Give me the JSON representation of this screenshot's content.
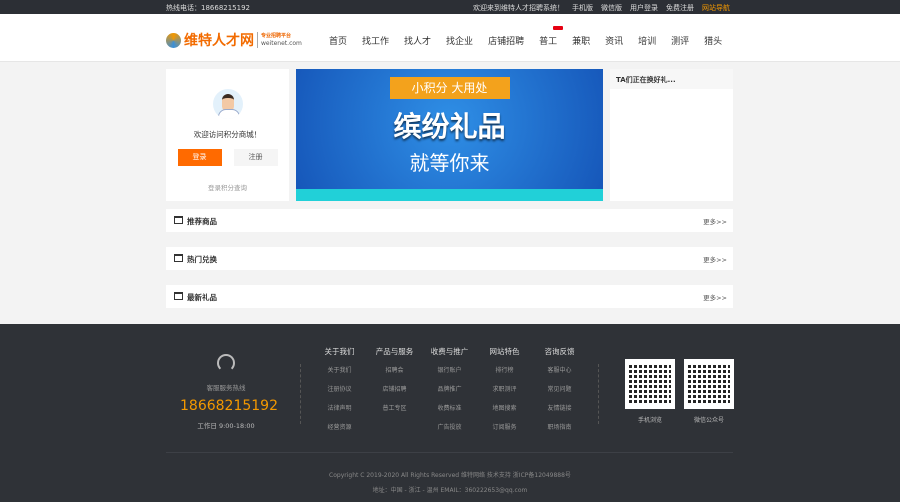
{
  "topbar": {
    "hotline": "热线电话：18668215192",
    "welcome": "欢迎来到维特人才招聘系统！",
    "links": [
      "手机版",
      "微信版",
      "用户登录",
      "免费注册",
      "网站导航"
    ]
  },
  "logo": {
    "name": "维特人才网",
    "slogan": "专业招聘平台",
    "domain": "weitenet.com"
  },
  "nav": [
    "首页",
    "找工作",
    "找人才",
    "找企业",
    "店铺招聘",
    "普工",
    "兼职",
    "资讯",
    "培训",
    "测评",
    "猎头"
  ],
  "user_card": {
    "welcome": "欢迎访问积分商城！",
    "login": "登录",
    "register": "注册",
    "query": "登录积分查询"
  },
  "banner": {
    "ribbon": "小积分 大用处",
    "title": "缤纷礼品",
    "subtitle": "就等你来"
  },
  "exchange_panel": {
    "title": "TA们正在换好礼..."
  },
  "sections": [
    {
      "title": "推荐商品",
      "more": "更多>>"
    },
    {
      "title": "热门兑换",
      "more": "更多>>"
    },
    {
      "title": "最新礼品",
      "more": "更多>>"
    }
  ],
  "footer": {
    "service_label": "客服服务热线",
    "phone": "18668215192",
    "hours": "工作日 9:00-18:00",
    "columns": [
      {
        "title": "关于我们",
        "items": [
          "关于我们",
          "注册协议",
          "法律声明",
          "经营资源"
        ]
      },
      {
        "title": "产品与服务",
        "items": [
          "招聘会",
          "店铺招聘",
          "普工专区"
        ]
      },
      {
        "title": "收费与推广",
        "items": [
          "银行账户",
          "品牌推广",
          "收费标准",
          "广告投放"
        ]
      },
      {
        "title": "网站特色",
        "items": [
          "排行榜",
          "求职测评",
          "地图搜索",
          "订阅服务"
        ]
      },
      {
        "title": "咨询反馈",
        "items": [
          "客服中心",
          "常见问题",
          "友情链接",
          "职场指南"
        ]
      }
    ],
    "qr": [
      "手机浏览",
      "微信公众号"
    ],
    "copyright": "Copyright C 2019-2020 All Rights Reserved 维特网络 技术支持 浙ICP备12049888号",
    "address": "地址：中国 - 浙江 - 温州 EMAIL：360222653@qq.com"
  }
}
